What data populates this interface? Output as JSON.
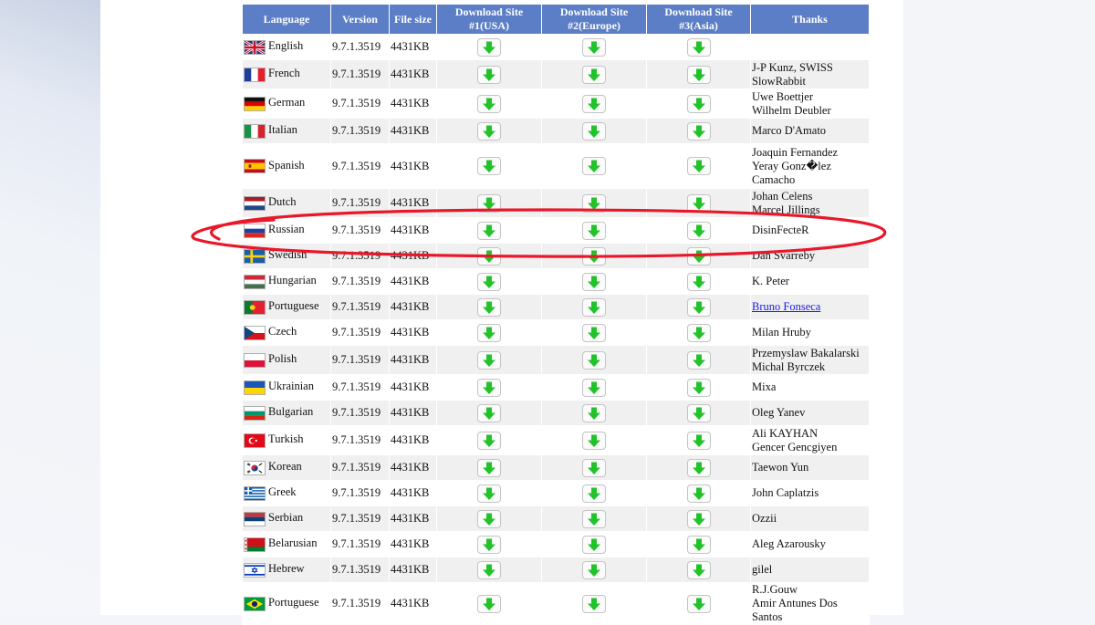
{
  "table": {
    "headers": {
      "language": "Language",
      "version": "Version",
      "filesize": "File size",
      "usa": [
        "Download Site",
        "#1(USA)"
      ],
      "europe": [
        "Download Site",
        "#2(Europe)"
      ],
      "asia": [
        "Download Site",
        "#3(Asia)"
      ],
      "thanks": "Thanks"
    },
    "rows": [
      {
        "flag": "uk",
        "language": "English",
        "version": "9.7.1.3519",
        "size": "4431KB",
        "thanks": [
          ""
        ]
      },
      {
        "flag": "fr",
        "language": "French",
        "version": "9.7.1.3519",
        "size": "4431KB",
        "thanks": [
          "J-P Kunz, SWISS",
          "SlowRabbit"
        ]
      },
      {
        "flag": "de",
        "language": "German",
        "version": "9.7.1.3519",
        "size": "4431KB",
        "thanks": [
          "Uwe Boettjer",
          "Wilhelm Deubler"
        ]
      },
      {
        "flag": "it",
        "language": "Italian",
        "version": "9.7.1.3519",
        "size": "4431KB",
        "thanks": [
          "Marco D'Amato"
        ]
      },
      {
        "flag": "es",
        "language": "Spanish",
        "version": "9.7.1.3519",
        "size": "4431KB",
        "thanks": [
          "Joaquin Fernandez",
          "Yeray Gonz�lez",
          "Camacho"
        ]
      },
      {
        "flag": "nl",
        "language": "Dutch",
        "version": "9.7.1.3519",
        "size": "4431KB",
        "thanks": [
          "Johan Celens",
          "Marcel Jillings"
        ]
      },
      {
        "flag": "ru",
        "language": "Russian",
        "version": "9.7.1.3519",
        "size": "4431KB",
        "thanks": [
          "DisinFecteR"
        ]
      },
      {
        "flag": "se",
        "language": "Swedish",
        "version": "9.7.1.3519",
        "size": "4431KB",
        "thanks": [
          "Dan Svarreby"
        ]
      },
      {
        "flag": "hu",
        "language": "Hungarian",
        "version": "9.7.1.3519",
        "size": "4431KB",
        "thanks": [
          "K. Peter"
        ]
      },
      {
        "flag": "pt",
        "language": "Portuguese",
        "version": "9.7.1.3519",
        "size": "4431KB",
        "thanks": [
          "Bruno Fonseca"
        ],
        "thanks_link": true
      },
      {
        "flag": "cz",
        "language": "Czech",
        "version": "9.7.1.3519",
        "size": "4431KB",
        "thanks": [
          "Milan Hruby"
        ]
      },
      {
        "flag": "pl",
        "language": "Polish",
        "version": "9.7.1.3519",
        "size": "4431KB",
        "thanks": [
          "Przemyslaw Bakalarski",
          "Michal Byrczek"
        ]
      },
      {
        "flag": "ua",
        "language": "Ukrainian",
        "version": "9.7.1.3519",
        "size": "4431KB",
        "thanks": [
          "Mixa"
        ]
      },
      {
        "flag": "bg",
        "language": "Bulgarian",
        "version": "9.7.1.3519",
        "size": "4431KB",
        "thanks": [
          "Oleg Yanev"
        ]
      },
      {
        "flag": "tr",
        "language": "Turkish",
        "version": "9.7.1.3519",
        "size": "4431KB",
        "thanks": [
          "Ali KAYHAN",
          "Gencer Gencgiyen"
        ]
      },
      {
        "flag": "kr",
        "language": "Korean",
        "version": "9.7.1.3519",
        "size": "4431KB",
        "thanks": [
          "Taewon Yun"
        ]
      },
      {
        "flag": "gr",
        "language": "Greek",
        "version": "9.7.1.3519",
        "size": "4431KB",
        "thanks": [
          "John Caplatzis"
        ]
      },
      {
        "flag": "rs",
        "language": "Serbian",
        "version": "9.7.1.3519",
        "size": "4431KB",
        "thanks": [
          "Ozzii"
        ]
      },
      {
        "flag": "by",
        "language": "Belarusian",
        "version": "9.7.1.3519",
        "size": "4431KB",
        "thanks": [
          "Aleg Azarousky"
        ]
      },
      {
        "flag": "il",
        "language": "Hebrew",
        "version": "9.7.1.3519",
        "size": "4431KB",
        "thanks": [
          "gilel"
        ]
      },
      {
        "flag": "br",
        "language": "Portuguese",
        "version": "9.7.1.3519",
        "size": "4431KB",
        "thanks": [
          "R.J.Gouw",
          "Amir Antunes Dos",
          "Santos"
        ]
      }
    ]
  },
  "colors": {
    "header_bg": "#5b7ec6",
    "row_alt_bg": "#f0f0f0",
    "download_arrow": "#22c32a",
    "annotation_circle": "#e8182a",
    "link": "#1a1ae6"
  },
  "icons": {
    "download": "download-arrow-icon",
    "annotation": "red-ellipse-annotation"
  }
}
